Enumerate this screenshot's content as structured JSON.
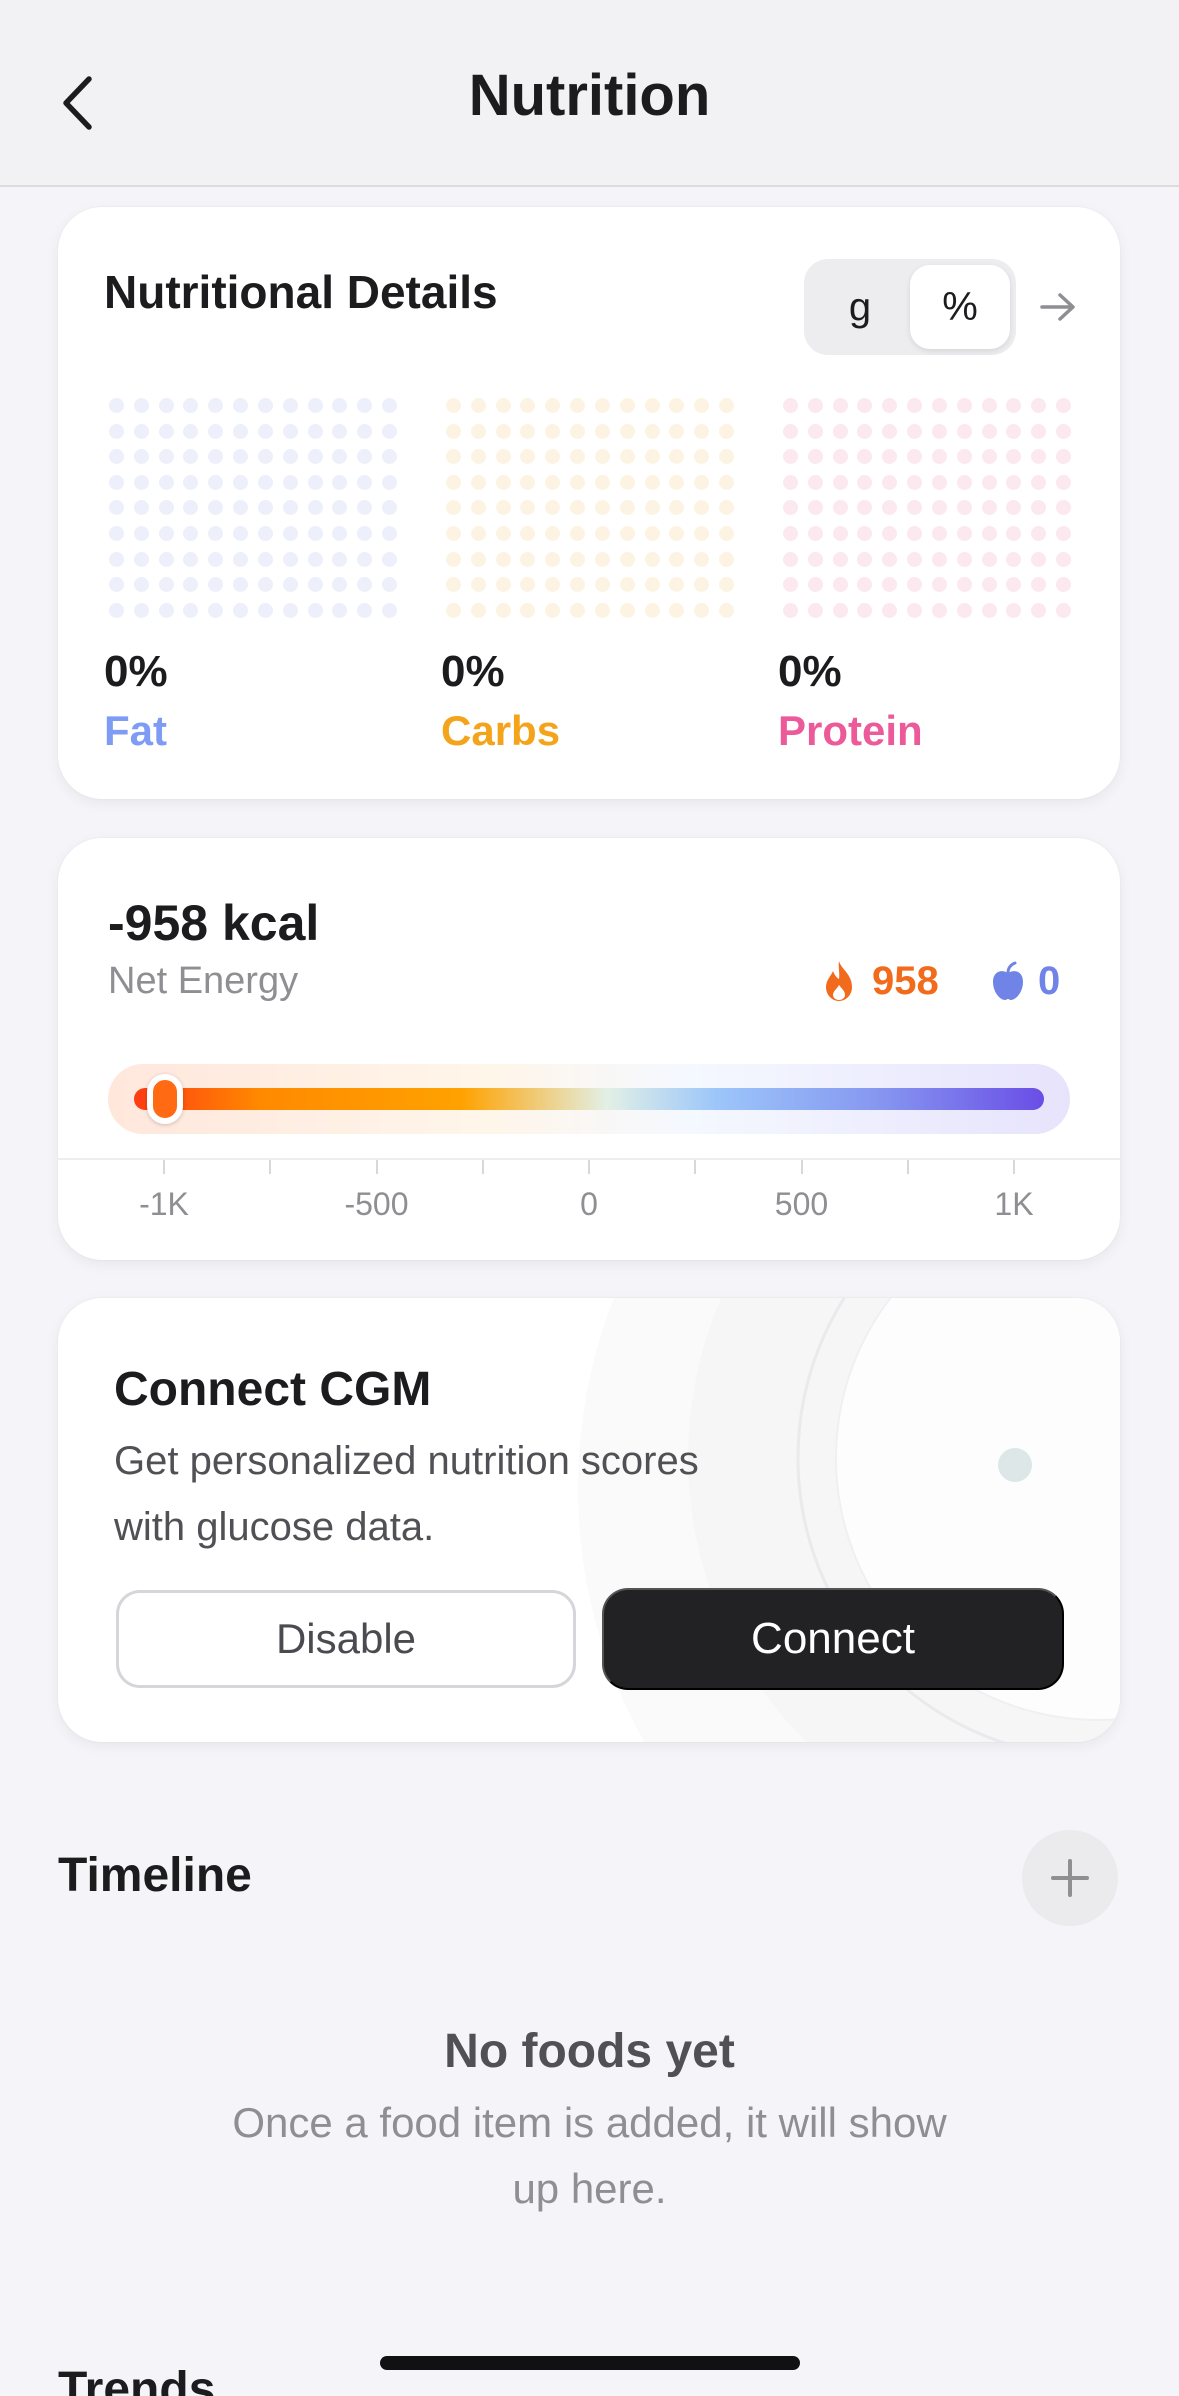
{
  "header": {
    "title": "Nutrition",
    "back_icon": "chevron-left-icon"
  },
  "nutritional_details": {
    "title": "Nutritional Details",
    "unit_toggle": {
      "options": [
        "g",
        "%"
      ],
      "selected": "%"
    },
    "arrow_icon": "arrow-right-icon",
    "macros": [
      {
        "value": "0%",
        "label": "Fat",
        "color": "#7f9cf5"
      },
      {
        "value": "0%",
        "label": "Carbs",
        "color": "#f4a41b"
      },
      {
        "value": "0%",
        "label": "Protein",
        "color": "#ec5a9a"
      }
    ]
  },
  "energy": {
    "value": "-958 kcal",
    "label": "Net Energy",
    "burned": "958",
    "burned_icon": "flame-icon",
    "eaten": "0",
    "eaten_icon": "apple-icon",
    "net_kcal": -958,
    "scale_min": -1000,
    "scale_max": 1000,
    "axis_labels": [
      "-1K",
      "-500",
      "0",
      "500",
      "1K"
    ]
  },
  "cgm": {
    "title": "Connect CGM",
    "description": "Get personalized nutrition scores with glucose data.",
    "disable_label": "Disable",
    "connect_label": "Connect"
  },
  "timeline": {
    "title": "Timeline",
    "add_icon": "plus-icon",
    "empty_title": "No foods yet",
    "empty_description": "Once a food item is added, it will show up here."
  },
  "trends": {
    "title": "Trends"
  }
}
